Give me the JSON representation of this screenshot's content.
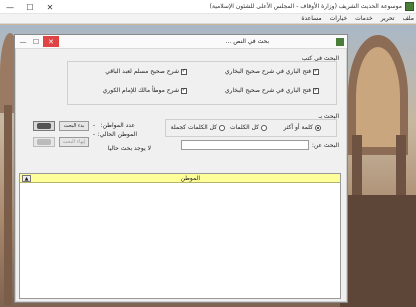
{
  "window": {
    "title": "موسوعة الحديث الشريف (وزارة الأوقاف - المجلس الأعلى للشئون الإسلامية)",
    "controls": {
      "minimize": "—",
      "maximize": "☐",
      "close": "✕"
    }
  },
  "menu": [
    "ملف",
    "تحرير",
    "خدمات",
    "خيارات",
    "مساعدة"
  ],
  "dialog": {
    "title": "بحث في النص ...",
    "controls": {
      "minimize": "—",
      "maximize": "☐",
      "close": "✕"
    },
    "books_group_label": "البحث في كتب",
    "books": [
      {
        "label": "فتح الباري في شرح صحيح البخاري",
        "checked": true
      },
      {
        "label": "شرح صحيح مسلم لعبد الباقي",
        "checked": true
      },
      {
        "label": "فتح الباري في شرح صحيح البخاري",
        "checked": true
      },
      {
        "label": "شرح موطأ مالك للإمام الكوري",
        "checked": true
      }
    ],
    "search_group_label": "البحث بـ",
    "search_modes": [
      {
        "label": "كلمة أو أكثر",
        "selected": true
      },
      {
        "label": "كل الكلمات",
        "selected": false
      },
      {
        "label": "كل الكلمات كجملة",
        "selected": false
      }
    ],
    "search_label": "البحث عن:",
    "search_value": "",
    "start_search_button": "بدء البحث",
    "stop_search_button": "إنهاء البحث",
    "count_label": "عدد المواطن:",
    "count_value": "-",
    "current_label": "الموطن الحالي:",
    "current_value": "-",
    "status_text": "لا يوجد بحث حاليا",
    "results_column": "الموطن",
    "sort_glyph": "▲"
  }
}
